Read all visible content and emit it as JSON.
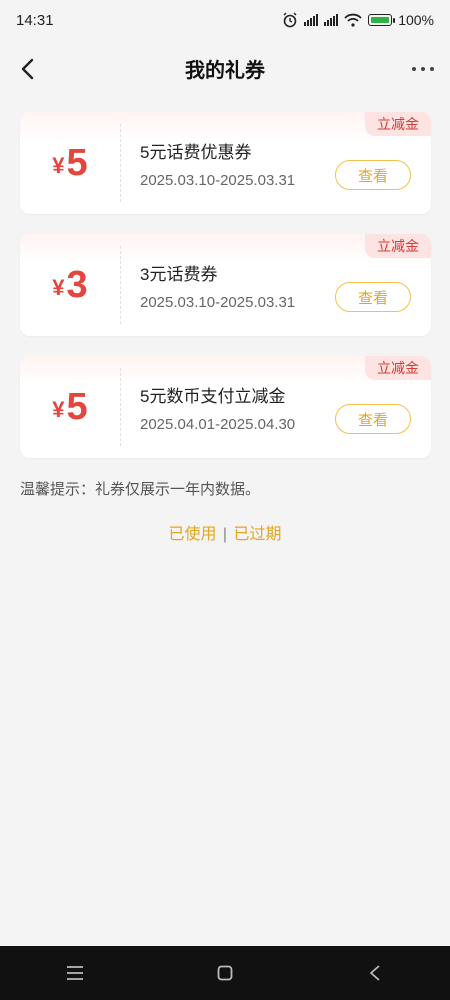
{
  "status_bar": {
    "time": "14:31",
    "battery": "100%"
  },
  "header": {
    "title": "我的礼券"
  },
  "coupons": [
    {
      "currency": "¥",
      "amount": "5",
      "name": "5元话费优惠券",
      "date_range": "2025.03.10-2025.03.31",
      "view_label": "查看",
      "tag": "立减金"
    },
    {
      "currency": "¥",
      "amount": "3",
      "name": "3元话费券",
      "date_range": "2025.03.10-2025.03.31",
      "view_label": "查看",
      "tag": "立减金"
    },
    {
      "currency": "¥",
      "amount": "5",
      "name": "5元数币支付立减金",
      "date_range": "2025.04.01-2025.04.30",
      "view_label": "查看",
      "tag": "立减金"
    }
  ],
  "tip": "温馨提示：礼券仅展示一年内数据。",
  "links": {
    "used": "已使用",
    "separator": "|",
    "expired": "已过期"
  },
  "colors": {
    "accent": "#e3a61e",
    "amount": "#e2463f",
    "tag_bg": "#fde3e1"
  }
}
